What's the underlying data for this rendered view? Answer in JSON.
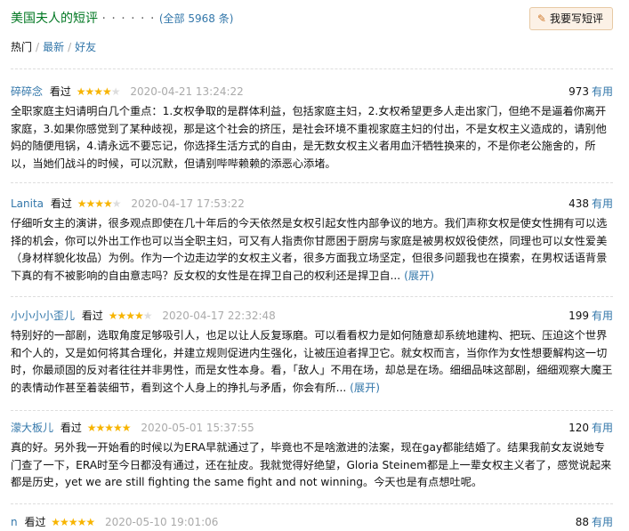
{
  "header": {
    "title": "美国夫人的短评",
    "dots": "· · · · · ·",
    "all_count": "全部 5968 条",
    "paren_open": "(",
    "paren_close": ")",
    "write_button": "我要写短评"
  },
  "tabs": {
    "hot": "热门",
    "latest": "最新",
    "friends": "好友",
    "separator": "/"
  },
  "colors": {
    "user_link": "#3377aa",
    "star": "#f7b400",
    "header_green": "#007722",
    "button_bg": "#fcf1e6"
  },
  "reviews": [
    {
      "user": "碎碎念",
      "status": "看过",
      "rating": 4,
      "time": "2020-04-21 13:24:22",
      "votes": "973",
      "useful_label": "有用",
      "content": "全职家庭主妇请明白几个重点：1.女权争取的是群体利益，包括家庭主妇，2.女权希望更多人走出家门，但绝不是逼着你离开家庭，3.如果你感觉到了某种歧视，那是这个社会的挤压，是社会环境不重视家庭主妇的付出，不是女权主义造成的，请别他妈的随便甩锅，4.请永远不要忘记，你选择生活方式的自由，是无数女权主义者用血汗牺牲换来的，不是你老公施舍的，所以，当她们战斗的时候，可以沉默，但请别哔哔赖赖的添恶心添堵。",
      "expand": ""
    },
    {
      "user": "Lanita",
      "status": "看过",
      "rating": 4,
      "time": "2020-04-17 17:53:22",
      "votes": "438",
      "useful_label": "有用",
      "content": "仔细听女主的演讲，很多观点即使在几十年后的今天依然是女权引起女性内部争议的地方。我们声称女权是使女性拥有可以选择的机会，你可以外出工作也可以当全职主妇，可又有人指责你甘愿困于厨房与家庭是被男权奴役使然，同理也可以女性爱美（身材样貌化妆品）为例。作为一个边走边学的女权主义者，很多方面我立场坚定，但很多问题我也在摸索，在男权话语背景下真的有不被影响的自由意志吗？反女权的女性是在捍卫自己的权利还是捍卫自... ",
      "expand": "(展开)"
    },
    {
      "user": "小小小小歪儿",
      "status": "看过",
      "rating": 4,
      "time": "2020-04-17 22:32:48",
      "votes": "199",
      "useful_label": "有用",
      "content": "特别好的一部剧，选取角度足够吸引人，也足以让人反复琢磨。可以看看权力是如何随意却系统地建构、把玩、压迫这个世界和个人的，又是如何将其合理化，并建立规则促进内生强化，让被压迫者捍卫它。就女权而言，当你作为女性想要解构这一切时，你最顽固的反对者往往并非男性，而是女性本身。看，「敌人」不用在场，却总是在场。细细品味这部剧，细细观察大魔王的表情动作甚至着装细节，看到这个人身上的挣扎与矛盾，你会有所... ",
      "expand": "(展开)"
    },
    {
      "user": "濛大板儿",
      "status": "看过",
      "rating": 5,
      "time": "2020-05-01 15:37:55",
      "votes": "120",
      "useful_label": "有用",
      "content": "真的好。另外我一开始看的时候以为ERA早就通过了，毕竟也不是啥激进的法案，现在gay都能结婚了。结果我前女友说她专门查了一下，ERA时至今日都没有通过，还在扯皮。我就觉得好绝望，Gloria Steinem都是上一辈女权主义者了，感觉说起来都是历史，yet we are still fighting the same fight and not winning。今天也是有点想吐呢。",
      "expand": ""
    },
    {
      "user": "n",
      "status": "看过",
      "rating": 5,
      "time": "2020-05-10 19:01:06",
      "votes": "88",
      "useful_label": "有用",
      "content": "",
      "expand": ""
    }
  ]
}
